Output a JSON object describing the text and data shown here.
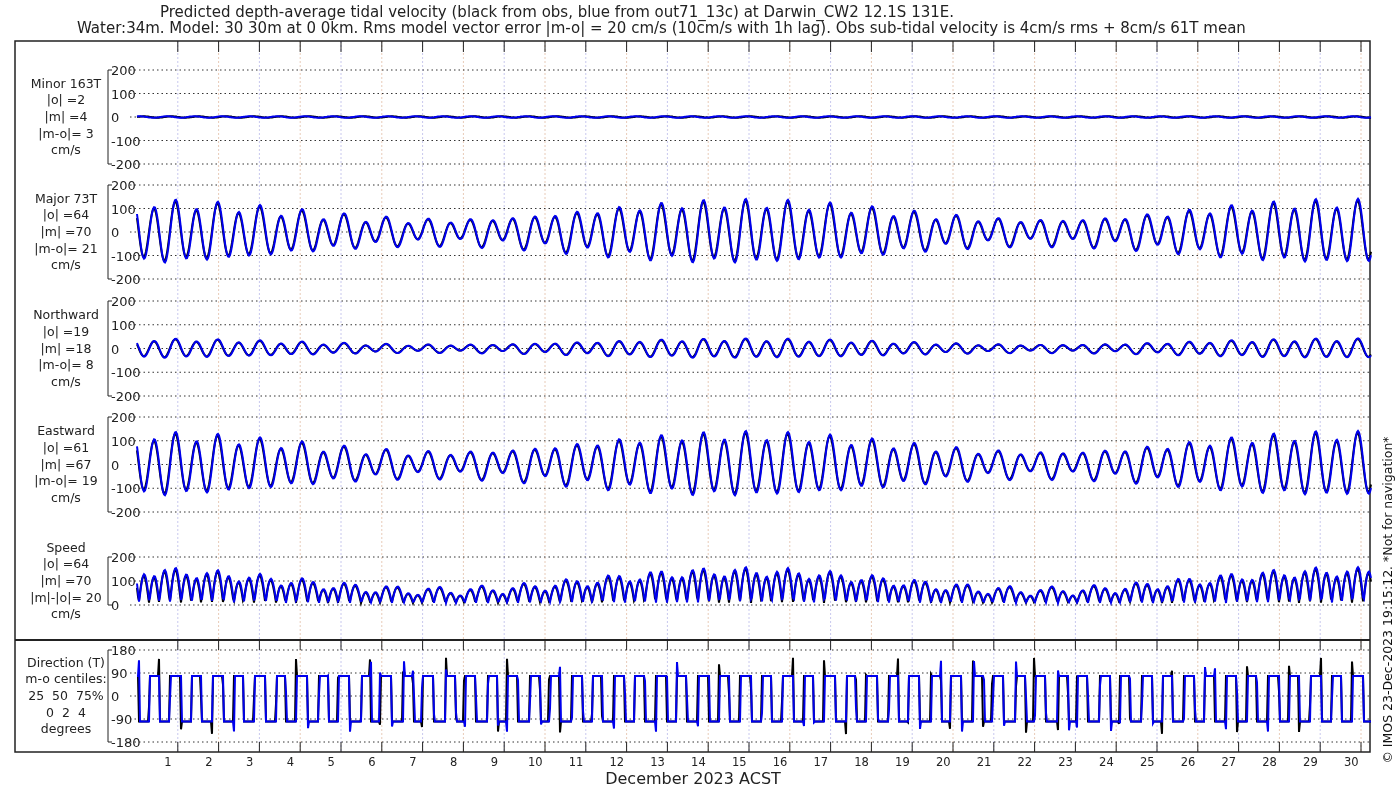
{
  "title_lines": [
    "Predicted depth-average tidal velocity (black from obs, blue from out71_13c) at Darwin_CW2 12.1S 131E.",
    "Water:34m. Model: 30 30m at 0 0km. Rms model vector error |m-o| = 20 cm/s (10cm/s with 1h lag). Obs sub-tidal velocity is 4cm/s rms + 8cm/s 61T mean"
  ],
  "panels": [
    {
      "kind": "flat",
      "label_lines": [
        "Minor 163T",
        "|o| =2",
        "|m| =4",
        "|m-o|= 3",
        "cm/s"
      ],
      "yticks": [
        "200",
        "100",
        "0",
        "-100",
        "-200"
      ]
    },
    {
      "kind": "wave",
      "label_lines": [
        "Major 73T",
        "|o| =64",
        "|m| =70",
        "|m-o|= 21",
        "cm/s"
      ],
      "yticks": [
        "200",
        "100",
        "0",
        "-100",
        "-200"
      ]
    },
    {
      "kind": "small-wave",
      "label_lines": [
        "Northward",
        "|o| =19",
        "|m| =18",
        "|m-o|= 8",
        "cm/s"
      ],
      "yticks": [
        "200",
        "100",
        "0",
        "-100",
        "-200"
      ]
    },
    {
      "kind": "wave",
      "label_lines": [
        "Eastward",
        "|o| =61",
        "|m| =67",
        "|m-o|= 19",
        "cm/s"
      ],
      "yticks": [
        "200",
        "100",
        "0",
        "-100",
        "-200"
      ]
    },
    {
      "kind": "speed",
      "label_lines": [
        "Speed",
        "|o| =64",
        "|m| =70",
        "|m|-|o|= 20",
        "cm/s"
      ],
      "yticks": [
        "200",
        "100",
        "0"
      ]
    },
    {
      "kind": "direction",
      "label_lines": [
        "Direction (T)",
        "m-o centiles:",
        "25  50  75%",
        "0  2  4",
        "degrees"
      ],
      "yticks": [
        "180",
        "90",
        "0",
        "-90",
        "-180"
      ]
    }
  ],
  "x_ticks": [
    "1",
    "2",
    "3",
    "4",
    "5",
    "6",
    "7",
    "8",
    "9",
    "10",
    "11",
    "12",
    "13",
    "14",
    "15",
    "16",
    "17",
    "18",
    "19",
    "20",
    "21",
    "22",
    "23",
    "24",
    "25",
    "26",
    "27",
    "28",
    "29",
    "30"
  ],
  "xlabel": "December 2023 ACST",
  "stamp": "© IMOS 23-Dec-2023 19:15:12.  *Not for navigation*"
}
